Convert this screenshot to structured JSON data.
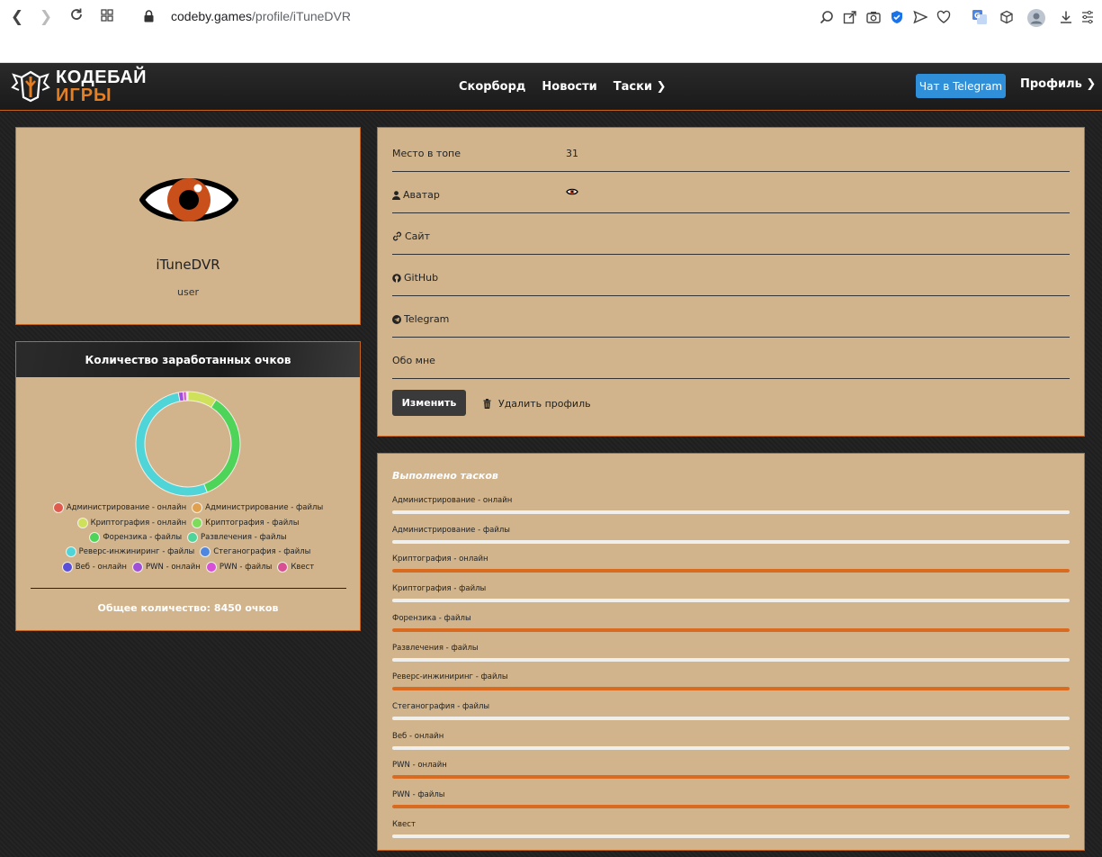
{
  "browser": {
    "url_host": "codeby.games",
    "url_path": "/profile/iTuneDVR"
  },
  "header": {
    "logo_line1": "КОДЕБАЙ",
    "logo_line2": "ИГРЫ",
    "nav": [
      {
        "label": "Скорборд"
      },
      {
        "label": "Новости"
      },
      {
        "label": "Таски"
      }
    ],
    "telegram_button": "Чат в Telegram",
    "profile_link": "Профиль"
  },
  "profile": {
    "username": "iTuneDVR",
    "role": "user"
  },
  "points": {
    "title": "Количество заработанных очков",
    "legend_rows": [
      [
        {
          "label": "Администрирование - онлайн",
          "color": "#e05a4d"
        },
        {
          "label": "Администрирование - файлы",
          "color": "#e0a04d"
        }
      ],
      [
        {
          "label": "Криптография - онлайн",
          "color": "#cfe05a"
        },
        {
          "label": "Криптография - файлы",
          "color": "#7ddc5a"
        }
      ],
      [
        {
          "label": "Форензика - файлы",
          "color": "#4fd45a"
        },
        {
          "label": "Развлечения - файлы",
          "color": "#4fd49a"
        }
      ],
      [
        {
          "label": "Реверс-инжиниринг - файлы",
          "color": "#4fd4d8"
        },
        {
          "label": "Стеганография - файлы",
          "color": "#4f86e0"
        }
      ],
      [
        {
          "label": "Веб - онлайн",
          "color": "#5a4fd8"
        },
        {
          "label": "PWN - онлайн",
          "color": "#a04fd8"
        },
        {
          "label": "PWN - файлы",
          "color": "#d84fd8"
        },
        {
          "label": "Квест",
          "color": "#d84f94"
        }
      ]
    ],
    "chart_data": {
      "type": "pie",
      "series": [
        {
          "name": "Криптография - онлайн",
          "share": 0.09,
          "color": "#cfe05a"
        },
        {
          "name": "Форензика - файлы",
          "share": 0.35,
          "color": "#4fd45a"
        },
        {
          "name": "Реверс-инжиниринг - файлы",
          "share": 0.53,
          "color": "#4fd4d8"
        },
        {
          "name": "PWN - онлайн",
          "share": 0.015,
          "color": "#a04fd8"
        },
        {
          "name": "PWN - файлы",
          "share": 0.01,
          "color": "#d84fd8"
        }
      ]
    },
    "total": "Общее количество: 8450 очков"
  },
  "info": {
    "rows": [
      {
        "label": "Место в топе",
        "value": "31",
        "icon": ""
      },
      {
        "label": "Аватар",
        "value": "",
        "icon": "user-icon"
      },
      {
        "label": "Сайт",
        "value": "",
        "icon": "link-icon"
      },
      {
        "label": "GitHub",
        "value": "",
        "icon": "github-icon"
      },
      {
        "label": "Telegram",
        "value": "",
        "icon": "telegram-icon"
      },
      {
        "label": "Обо мне",
        "value": "",
        "icon": ""
      }
    ],
    "edit_button": "Изменить",
    "delete_button": "Удалить профиль"
  },
  "tasks": {
    "title": "Выполнено тасков",
    "items": [
      {
        "label": "Администрирование - онлайн",
        "progress": 0
      },
      {
        "label": "Администрирование - файлы",
        "progress": 0
      },
      {
        "label": "Криптография - онлайн",
        "progress": 1
      },
      {
        "label": "Криптография - файлы",
        "progress": 0
      },
      {
        "label": "Форензика - файлы",
        "progress": 1
      },
      {
        "label": "Развлечения - файлы",
        "progress": 0
      },
      {
        "label": "Реверс-инжиниринг - файлы",
        "progress": 1
      },
      {
        "label": "Стеганография - файлы",
        "progress": 0
      },
      {
        "label": "Веб - онлайн",
        "progress": 0
      },
      {
        "label": "PWN - онлайн",
        "progress": 1
      },
      {
        "label": "PWN - файлы",
        "progress": 1
      },
      {
        "label": "Квест",
        "progress": 0
      }
    ]
  }
}
